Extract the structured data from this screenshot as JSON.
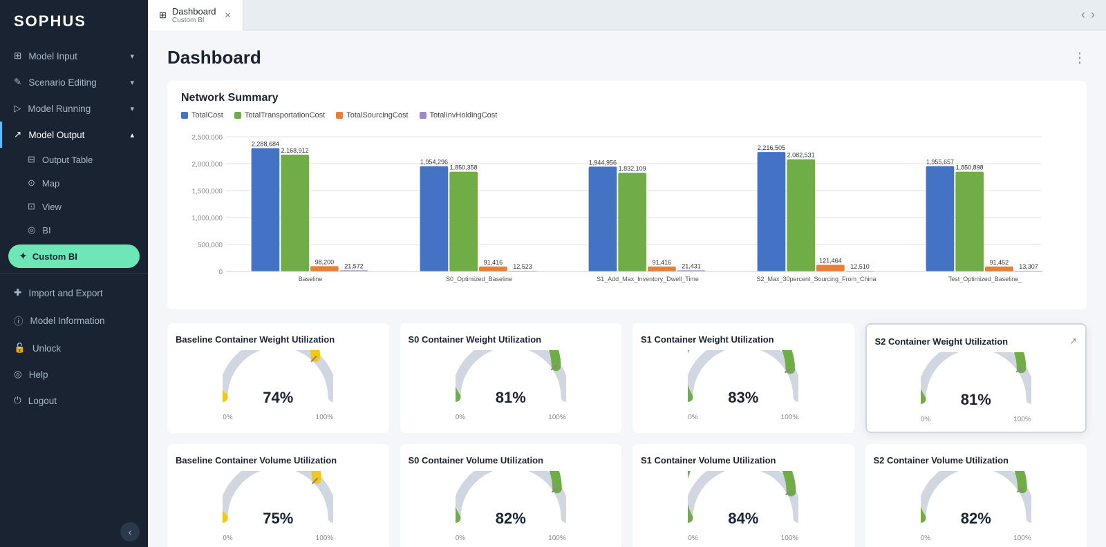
{
  "app": {
    "logo": "SOPHUS"
  },
  "sidebar": {
    "nav_items": [
      {
        "id": "model-input",
        "label": "Model Input",
        "icon": "grid",
        "has_chevron": true,
        "active": false
      },
      {
        "id": "scenario-editing",
        "label": "Scenario Editing",
        "icon": "edit",
        "has_chevron": true,
        "active": false
      },
      {
        "id": "model-running",
        "label": "Model Running",
        "icon": "play",
        "has_chevron": true,
        "active": false
      },
      {
        "id": "model-output",
        "label": "Model Output",
        "icon": "chart",
        "has_chevron": true,
        "active": true
      }
    ],
    "sub_items": [
      {
        "id": "output-table",
        "label": "Output Table",
        "icon": "table"
      },
      {
        "id": "map",
        "label": "Map",
        "icon": "map"
      },
      {
        "id": "view",
        "label": "View",
        "icon": "view"
      },
      {
        "id": "bi",
        "label": "BI",
        "icon": "bi"
      }
    ],
    "custom_bi": "Custom BI",
    "bottom_items": [
      {
        "id": "import-export",
        "label": "Import and Export",
        "icon": "plus"
      },
      {
        "id": "model-info",
        "label": "Model Information",
        "icon": "info"
      },
      {
        "id": "unlock",
        "label": "Unlock",
        "icon": "lock"
      },
      {
        "id": "help",
        "label": "Help",
        "icon": "help"
      },
      {
        "id": "logout",
        "label": "Logout",
        "icon": "logout"
      }
    ]
  },
  "tab_bar": {
    "tabs": [
      {
        "id": "dashboard",
        "title": "Dashboard",
        "subtitle": "Custom BI",
        "active": true
      }
    ],
    "nav_prev": "‹",
    "nav_next": "›"
  },
  "dashboard": {
    "title": "Dashboard",
    "network_summary": {
      "section_title": "Network Summary",
      "legend": [
        {
          "label": "TotalCost",
          "color": "#4472c4"
        },
        {
          "label": "TotalTransportationCost",
          "color": "#70ad47"
        },
        {
          "label": "TotalSourcingCost",
          "color": "#ed7d31"
        },
        {
          "label": "TotalInvHoldingCost",
          "color": "#9e86c8"
        }
      ],
      "bars": [
        {
          "scenario": "Baseline",
          "values": [
            2288684,
            2168912,
            98200,
            21572
          ]
        },
        {
          "scenario": "S0_Optimized_Baseline",
          "values": [
            1954296,
            1850358,
            91416,
            12523
          ]
        },
        {
          "scenario": "S1_Add_Max_Inventory_Dwell_Time",
          "values": [
            1944956,
            1832109,
            91416,
            21431
          ]
        },
        {
          "scenario": "S2_Max_30percent_Sourcing_From_China",
          "values": [
            2216505,
            2082531,
            121464,
            12510
          ]
        },
        {
          "scenario": "Test_Optimized_Baseline_",
          "values": [
            1955657,
            1850898,
            91452,
            13307
          ]
        }
      ],
      "y_labels": [
        "0",
        "500,000",
        "1,000,000",
        "1,500,000",
        "2,000,000",
        "2,500,000"
      ]
    },
    "weight_utilization": {
      "section_title": "Container Weight Utilization",
      "cards": [
        {
          "title": "Baseline Container Weight Utilization",
          "percent": 74,
          "color": "#f5c518",
          "highlighted": false
        },
        {
          "title": "S0 Container Weight Utilization",
          "percent": 81,
          "color": "#70ad47",
          "highlighted": false
        },
        {
          "title": "S1 Container Weight Utilization",
          "percent": 83,
          "color": "#70ad47",
          "highlighted": false
        },
        {
          "title": "S2 Container Weight Utilization",
          "percent": 81,
          "color": "#70ad47",
          "highlighted": true
        }
      ]
    },
    "volume_utilization": {
      "section_title": "Container Volume Utilization",
      "cards": [
        {
          "title": "Baseline Container Volume Utilization",
          "percent": 75,
          "color": "#f5c518",
          "highlighted": false
        },
        {
          "title": "S0 Container Volume Utilization",
          "percent": 82,
          "color": "#70ad47",
          "highlighted": false
        },
        {
          "title": "S1 Container Volume Utilization",
          "percent": 84,
          "color": "#70ad47",
          "highlighted": false
        },
        {
          "title": "S2 Container Volume Utilization",
          "percent": 82,
          "color": "#70ad47",
          "highlighted": false
        }
      ]
    }
  }
}
